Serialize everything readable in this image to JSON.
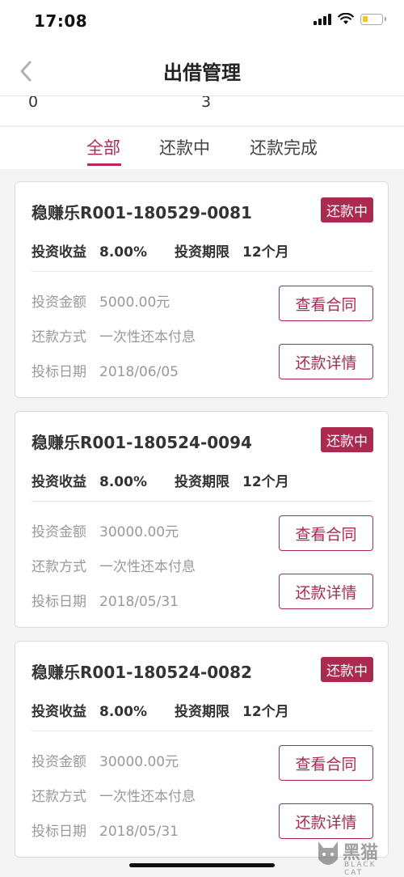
{
  "status_bar": {
    "time": "17:08"
  },
  "nav": {
    "title": "出借管理"
  },
  "summary": {
    "values": [
      "0",
      "3"
    ]
  },
  "tabs": [
    {
      "label": "全部",
      "active": true
    },
    {
      "label": "还款中",
      "active": false
    },
    {
      "label": "还款完成",
      "active": false
    }
  ],
  "cards": [
    {
      "title": "稳赚乐R001-180529-0081",
      "status": "还款中",
      "yield_label": "投资收益",
      "yield_value": "8.00%",
      "term_label": "投资期限",
      "term_value": "12个月",
      "amount_label": "投资金额",
      "amount_value": "5000.00元",
      "method_label": "还款方式",
      "method_value": "一次性还本付息",
      "date_label": "投标日期",
      "date_value": "2018/06/05",
      "contract_button": "查看合同",
      "detail_button": "还款详情"
    },
    {
      "title": "稳赚乐R001-180524-0094",
      "status": "还款中",
      "yield_label": "投资收益",
      "yield_value": "8.00%",
      "term_label": "投资期限",
      "term_value": "12个月",
      "amount_label": "投资金额",
      "amount_value": "30000.00元",
      "method_label": "还款方式",
      "method_value": "一次性还本付息",
      "date_label": "投标日期",
      "date_value": "2018/05/31",
      "contract_button": "查看合同",
      "detail_button": "还款详情"
    },
    {
      "title": "稳赚乐R001-180524-0082",
      "status": "还款中",
      "yield_label": "投资收益",
      "yield_value": "8.00%",
      "term_label": "投资期限",
      "term_value": "12个月",
      "amount_label": "投资金额",
      "amount_value": "30000.00元",
      "method_label": "还款方式",
      "method_value": "一次性还本付息",
      "date_label": "投标日期",
      "date_value": "2018/05/31",
      "contract_button": "查看合同",
      "detail_button": "还款详情"
    }
  ],
  "watermark": {
    "text": "黑猫",
    "sub": "BLACK CAT"
  },
  "colors": {
    "accent": "#ab2a4e",
    "tab_active": "#b22a55",
    "battery": "#f5c518"
  },
  "icons": [
    "signal-icon",
    "wifi-icon",
    "battery-icon",
    "back-chevron-icon",
    "cat-logo-icon"
  ]
}
